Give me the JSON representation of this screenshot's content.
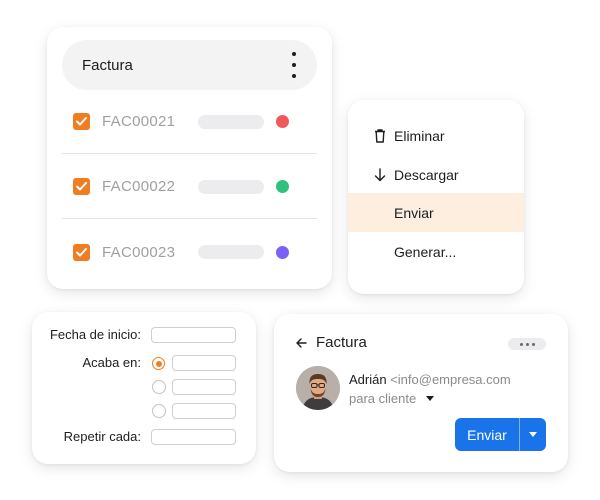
{
  "invoice_list": {
    "title": "Factura",
    "items": [
      {
        "code": "FAC00021",
        "checked": true,
        "status_color": "#f0585a"
      },
      {
        "code": "FAC00022",
        "checked": true,
        "status_color": "#2ec27e"
      },
      {
        "code": "FAC00023",
        "checked": true,
        "status_color": "#7b61f8"
      }
    ]
  },
  "context_menu": {
    "items": [
      {
        "label": "Eliminar",
        "icon": "trash-icon"
      },
      {
        "label": "Descargar",
        "icon": "arrow-down-icon"
      },
      {
        "label": "Enviar",
        "icon": "",
        "highlighted": true
      },
      {
        "label": "Generar...",
        "icon": ""
      }
    ]
  },
  "schedule_form": {
    "start_label": "Fecha de inicio:",
    "ends_label": "Acaba en:",
    "repeat_label": "Repetir cada:",
    "selected_end_option": 0
  },
  "email_card": {
    "title": "Factura",
    "sender_name": "Adrián",
    "sender_email": "<info@empresa.com",
    "recipient": "para cliente",
    "send_label": "Enviar"
  },
  "colors": {
    "accent_orange": "#f07d21",
    "primary_blue": "#1a73e8",
    "highlight": "#fdeee0"
  }
}
